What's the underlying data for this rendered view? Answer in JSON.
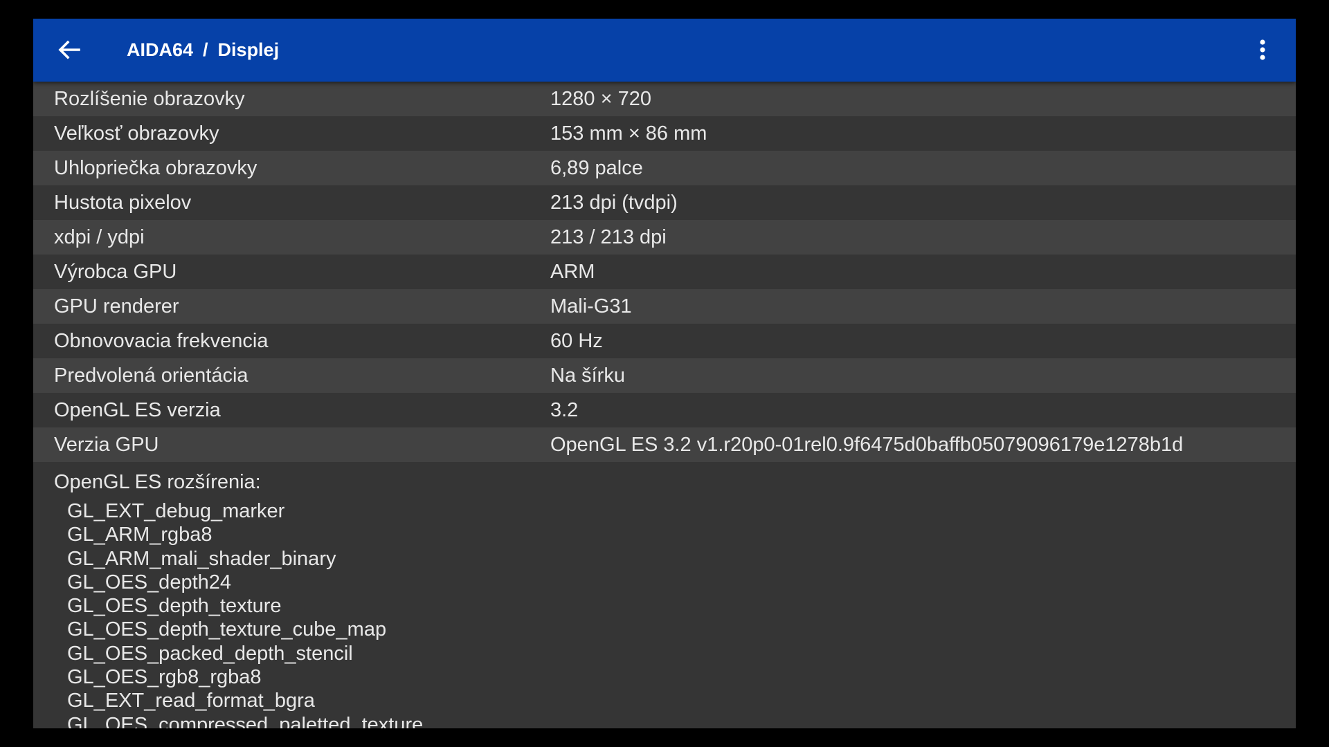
{
  "appbar": {
    "app_name": "AIDA64",
    "separator": "/",
    "page_title": "Displej",
    "back_icon": "arrow-left-icon",
    "menu_icon": "more-vertical-icon",
    "background_color": "#0641a8"
  },
  "rows": [
    {
      "label": "Rozlíšenie obrazovky",
      "value": "1280 × 720"
    },
    {
      "label": "Veľkosť obrazovky",
      "value": "153 mm × 86 mm"
    },
    {
      "label": "Uhlopriečka obrazovky",
      "value": "6,89 palce"
    },
    {
      "label": "Hustota pixelov",
      "value": "213 dpi (tvdpi)"
    },
    {
      "label": "xdpi / ydpi",
      "value": "213 / 213 dpi"
    },
    {
      "label": "Výrobca GPU",
      "value": "ARM"
    },
    {
      "label": "GPU renderer",
      "value": "Mali-G31"
    },
    {
      "label": "Obnovovacia frekvencia",
      "value": "60 Hz"
    },
    {
      "label": "Predvolená orientácia",
      "value": "Na šírku"
    },
    {
      "label": "OpenGL ES verzia",
      "value": "3.2"
    },
    {
      "label": "Verzia GPU",
      "value": "OpenGL ES 3.2 v1.r20p0-01rel0.9f6475d0baffb05079096179e1278b1d"
    }
  ],
  "extensions": {
    "title": "OpenGL ES rozšírenia:",
    "items": [
      "GL_EXT_debug_marker",
      "GL_ARM_rgba8",
      "GL_ARM_mali_shader_binary",
      "GL_OES_depth24",
      "GL_OES_depth_texture",
      "GL_OES_depth_texture_cube_map",
      "GL_OES_packed_depth_stencil",
      "GL_OES_rgb8_rgba8",
      "GL_EXT_read_format_bgra",
      "GL_OES_compressed_paletted_texture"
    ]
  }
}
